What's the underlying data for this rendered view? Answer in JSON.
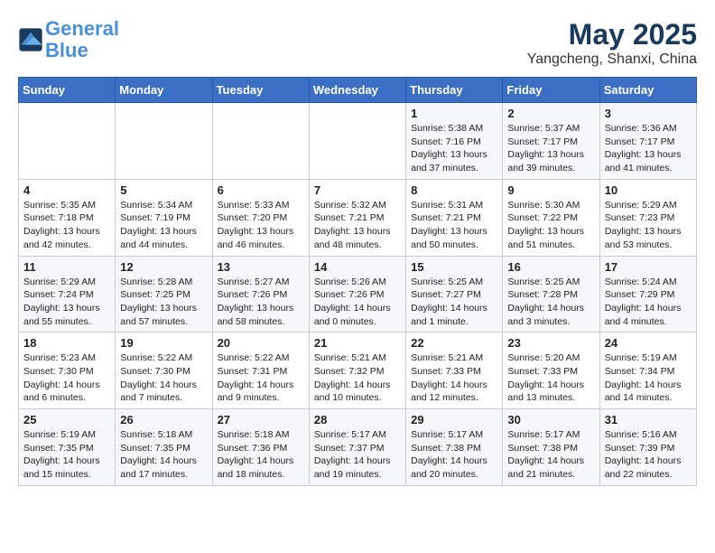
{
  "header": {
    "logo_line1": "General",
    "logo_line2": "Blue",
    "month": "May 2025",
    "location": "Yangcheng, Shanxi, China"
  },
  "days_of_week": [
    "Sunday",
    "Monday",
    "Tuesday",
    "Wednesday",
    "Thursday",
    "Friday",
    "Saturday"
  ],
  "weeks": [
    [
      {
        "day": "",
        "info": ""
      },
      {
        "day": "",
        "info": ""
      },
      {
        "day": "",
        "info": ""
      },
      {
        "day": "",
        "info": ""
      },
      {
        "day": "1",
        "info": "Sunrise: 5:38 AM\nSunset: 7:16 PM\nDaylight: 13 hours\nand 37 minutes."
      },
      {
        "day": "2",
        "info": "Sunrise: 5:37 AM\nSunset: 7:17 PM\nDaylight: 13 hours\nand 39 minutes."
      },
      {
        "day": "3",
        "info": "Sunrise: 5:36 AM\nSunset: 7:17 PM\nDaylight: 13 hours\nand 41 minutes."
      }
    ],
    [
      {
        "day": "4",
        "info": "Sunrise: 5:35 AM\nSunset: 7:18 PM\nDaylight: 13 hours\nand 42 minutes."
      },
      {
        "day": "5",
        "info": "Sunrise: 5:34 AM\nSunset: 7:19 PM\nDaylight: 13 hours\nand 44 minutes."
      },
      {
        "day": "6",
        "info": "Sunrise: 5:33 AM\nSunset: 7:20 PM\nDaylight: 13 hours\nand 46 minutes."
      },
      {
        "day": "7",
        "info": "Sunrise: 5:32 AM\nSunset: 7:21 PM\nDaylight: 13 hours\nand 48 minutes."
      },
      {
        "day": "8",
        "info": "Sunrise: 5:31 AM\nSunset: 7:21 PM\nDaylight: 13 hours\nand 50 minutes."
      },
      {
        "day": "9",
        "info": "Sunrise: 5:30 AM\nSunset: 7:22 PM\nDaylight: 13 hours\nand 51 minutes."
      },
      {
        "day": "10",
        "info": "Sunrise: 5:29 AM\nSunset: 7:23 PM\nDaylight: 13 hours\nand 53 minutes."
      }
    ],
    [
      {
        "day": "11",
        "info": "Sunrise: 5:29 AM\nSunset: 7:24 PM\nDaylight: 13 hours\nand 55 minutes."
      },
      {
        "day": "12",
        "info": "Sunrise: 5:28 AM\nSunset: 7:25 PM\nDaylight: 13 hours\nand 57 minutes."
      },
      {
        "day": "13",
        "info": "Sunrise: 5:27 AM\nSunset: 7:26 PM\nDaylight: 13 hours\nand 58 minutes."
      },
      {
        "day": "14",
        "info": "Sunrise: 5:26 AM\nSunset: 7:26 PM\nDaylight: 14 hours\nand 0 minutes."
      },
      {
        "day": "15",
        "info": "Sunrise: 5:25 AM\nSunset: 7:27 PM\nDaylight: 14 hours\nand 1 minute."
      },
      {
        "day": "16",
        "info": "Sunrise: 5:25 AM\nSunset: 7:28 PM\nDaylight: 14 hours\nand 3 minutes."
      },
      {
        "day": "17",
        "info": "Sunrise: 5:24 AM\nSunset: 7:29 PM\nDaylight: 14 hours\nand 4 minutes."
      }
    ],
    [
      {
        "day": "18",
        "info": "Sunrise: 5:23 AM\nSunset: 7:30 PM\nDaylight: 14 hours\nand 6 minutes."
      },
      {
        "day": "19",
        "info": "Sunrise: 5:22 AM\nSunset: 7:30 PM\nDaylight: 14 hours\nand 7 minutes."
      },
      {
        "day": "20",
        "info": "Sunrise: 5:22 AM\nSunset: 7:31 PM\nDaylight: 14 hours\nand 9 minutes."
      },
      {
        "day": "21",
        "info": "Sunrise: 5:21 AM\nSunset: 7:32 PM\nDaylight: 14 hours\nand 10 minutes."
      },
      {
        "day": "22",
        "info": "Sunrise: 5:21 AM\nSunset: 7:33 PM\nDaylight: 14 hours\nand 12 minutes."
      },
      {
        "day": "23",
        "info": "Sunrise: 5:20 AM\nSunset: 7:33 PM\nDaylight: 14 hours\nand 13 minutes."
      },
      {
        "day": "24",
        "info": "Sunrise: 5:19 AM\nSunset: 7:34 PM\nDaylight: 14 hours\nand 14 minutes."
      }
    ],
    [
      {
        "day": "25",
        "info": "Sunrise: 5:19 AM\nSunset: 7:35 PM\nDaylight: 14 hours\nand 15 minutes."
      },
      {
        "day": "26",
        "info": "Sunrise: 5:18 AM\nSunset: 7:35 PM\nDaylight: 14 hours\nand 17 minutes."
      },
      {
        "day": "27",
        "info": "Sunrise: 5:18 AM\nSunset: 7:36 PM\nDaylight: 14 hours\nand 18 minutes."
      },
      {
        "day": "28",
        "info": "Sunrise: 5:17 AM\nSunset: 7:37 PM\nDaylight: 14 hours\nand 19 minutes."
      },
      {
        "day": "29",
        "info": "Sunrise: 5:17 AM\nSunset: 7:38 PM\nDaylight: 14 hours\nand 20 minutes."
      },
      {
        "day": "30",
        "info": "Sunrise: 5:17 AM\nSunset: 7:38 PM\nDaylight: 14 hours\nand 21 minutes."
      },
      {
        "day": "31",
        "info": "Sunrise: 5:16 AM\nSunset: 7:39 PM\nDaylight: 14 hours\nand 22 minutes."
      }
    ]
  ]
}
